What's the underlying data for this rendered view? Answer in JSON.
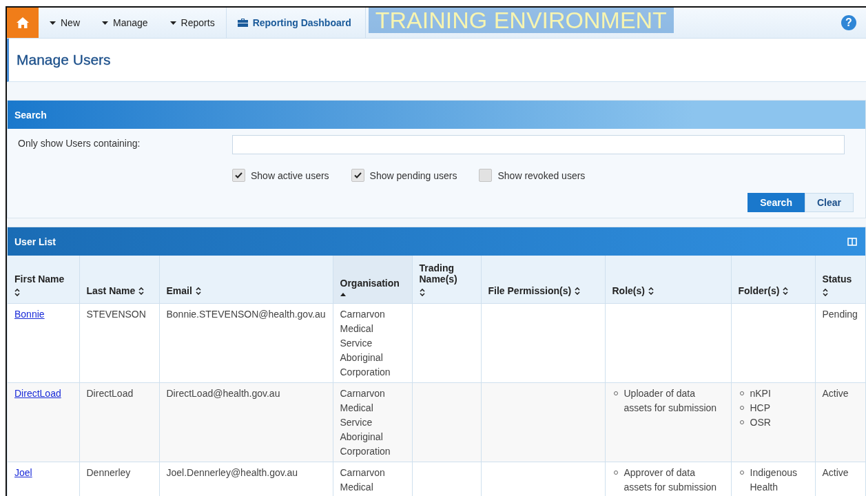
{
  "nav": {
    "items": [
      {
        "label": "New",
        "kind": "dropdown"
      },
      {
        "label": "Manage",
        "kind": "dropdown"
      },
      {
        "label": "Reports",
        "kind": "dropdown"
      },
      {
        "label": "Reporting Dashboard",
        "kind": "briefcase"
      }
    ],
    "banner": "TRAINING ENVIRONMENT",
    "help": "?"
  },
  "page_title": "Manage Users",
  "search": {
    "title": "Search",
    "label": "Only show Users containing:",
    "options": [
      {
        "label": "Show active users",
        "checked": true
      },
      {
        "label": "Show pending users",
        "checked": true
      },
      {
        "label": "Show revoked users",
        "checked": false
      }
    ],
    "buttons": [
      {
        "label": "Search",
        "kind": "primary"
      },
      {
        "label": "Clear",
        "kind": "secondary"
      }
    ]
  },
  "user_list": {
    "title": "User List",
    "columns": [
      {
        "label": "First Name",
        "sorted": false
      },
      {
        "label": "Last Name",
        "sorted": false
      },
      {
        "label": "Email",
        "sorted": false
      },
      {
        "label": "Organisation",
        "sorted": true
      },
      {
        "label": "Trading Name(s)",
        "sorted": false
      },
      {
        "label": "File Permission(s)",
        "sorted": false
      },
      {
        "label": "Role(s)",
        "sorted": false
      },
      {
        "label": "Folder(s)",
        "sorted": false
      },
      {
        "label": "Status",
        "sorted": false
      }
    ],
    "rows": [
      {
        "first_name": "Bonnie",
        "last_name": "STEVENSON",
        "email": "Bonnie.STEVENSON@health.gov.au",
        "organisation": "Carnarvon Medical Service Aboriginal Corporation",
        "roles": [],
        "folders": [],
        "status": "Pending"
      },
      {
        "first_name": "DirectLoad",
        "last_name": "DirectLoad",
        "email": "DirectLoad@health.gov.au",
        "organisation": "Carnarvon Medical Service Aboriginal Corporation",
        "roles": [
          "Uploader of data assets for submission"
        ],
        "folders": [
          "nKPI",
          "HCP",
          "OSR"
        ],
        "status": "Active"
      },
      {
        "first_name": "Joel",
        "last_name": "Dennerley",
        "email": "Joel.Dennerley@health.gov.au",
        "organisation": "Carnarvon Medical",
        "roles": [
          "Approver of data assets for submission"
        ],
        "folders": [
          "Indigenous Health"
        ],
        "status": "Active"
      }
    ]
  }
}
